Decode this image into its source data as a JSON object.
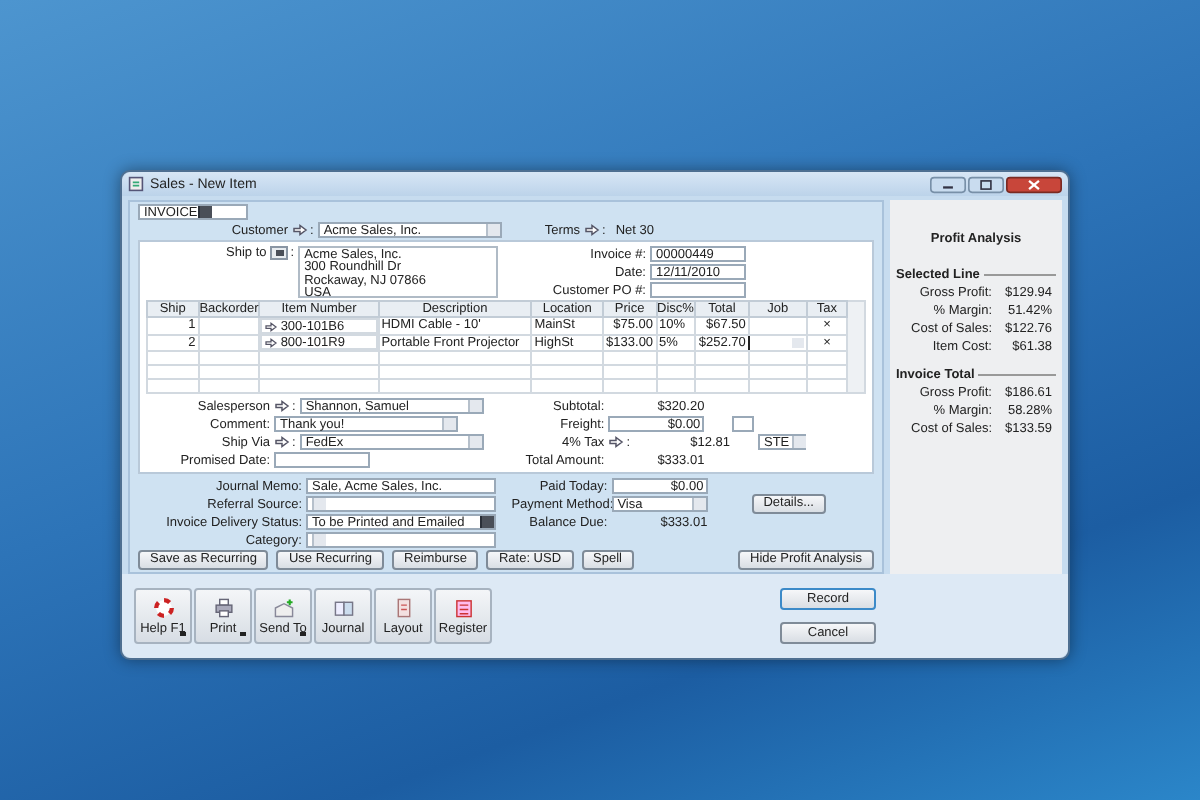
{
  "window": {
    "title": "Sales - New Item"
  },
  "form_type": {
    "value": "INVOICE"
  },
  "customer": {
    "label": "Customer",
    "separator": ":",
    "value": "Acme Sales, Inc."
  },
  "terms": {
    "label": "Terms",
    "separator": ":",
    "value": "Net 30"
  },
  "ship_to": {
    "label": "Ship to",
    "separator": ":",
    "address": [
      "Acme Sales, Inc.",
      "300 Roundhill Dr",
      "Rockaway, NJ 07866",
      "USA"
    ]
  },
  "invoice_fields": [
    {
      "label": "Invoice #:",
      "value": "00000449"
    },
    {
      "label": "Date:",
      "value": "12/11/2010"
    },
    {
      "label": "Customer PO #:"
    }
  ],
  "table": {
    "columns": [
      "Ship",
      "Backorder",
      "Item Number",
      "Description",
      "Location",
      "Price",
      "Disc%",
      "Total",
      "Job",
      "Tax"
    ],
    "rows": [
      {
        "ship": "1",
        "item_number": "300-101B6",
        "description": "HDMI Cable - 10'",
        "location": "MainSt",
        "price": "$75.00",
        "disc": "10%",
        "total": "$67.50",
        "tax": "×",
        "selected": false
      },
      {
        "ship": "2",
        "item_number": "800-101R9",
        "description": "Portable Front Projector",
        "location": "HighSt",
        "price": "$133.00",
        "disc": "5%",
        "total": "$252.70",
        "tax": "×",
        "selected": true
      }
    ]
  },
  "order_fields": [
    {
      "label": "Salesperson",
      "separator": ":",
      "value": "Shannon, Samuel",
      "arrow": true,
      "dropdown": true
    },
    {
      "label": "Comment:",
      "value": "Thank you!",
      "arrow": false,
      "dropdown": true
    },
    {
      "label": "Ship Via",
      "separator": ":",
      "value": "FedEx",
      "arrow": true,
      "dropdown": true
    },
    {
      "label": "Promised Date:",
      "arrow": false,
      "dropdown": false
    }
  ],
  "totals": [
    {
      "label": "Subtotal:",
      "value": "$320.20",
      "kind": "text",
      "arrow": false
    },
    {
      "label": "Freight:",
      "value": "$0.00",
      "kind": "field",
      "arrow": false,
      "checked": false
    },
    {
      "label": "4% Tax",
      "separator": ":",
      "value": "$12.81",
      "kind": "tax",
      "code": "STE",
      "arrow": true
    },
    {
      "label": "Total Amount:",
      "value": "$333.01",
      "kind": "text",
      "arrow": false
    }
  ],
  "memo_fields": [
    {
      "label": "Journal Memo:",
      "value": "Sale, Acme Sales, Inc.",
      "kind": "text"
    },
    {
      "label": "Referral Source:",
      "kind": "combo"
    },
    {
      "label": "Invoice Delivery Status:",
      "value": "To be Printed and Emailed",
      "kind": "select"
    },
    {
      "label": "Category:",
      "kind": "combo"
    }
  ],
  "payment_fields": [
    {
      "label": "Paid Today:",
      "value": "$0.00",
      "kind": "text"
    },
    {
      "label": "Payment Method:",
      "value": "Visa",
      "kind": "combo"
    },
    {
      "label": "Balance Due:",
      "value": "$333.01",
      "kind": "plain"
    }
  ],
  "details_button": "Details...",
  "action_buttons": [
    "Save as Recurring",
    "Use Recurring",
    "Reimburse",
    "Rate: USD",
    "Spell"
  ],
  "hide_profit_button": "Hide Profit Analysis",
  "toolbar": [
    {
      "label": "Help F1",
      "kind": "help",
      "has_menu": true
    },
    {
      "label": "Print",
      "kind": "print",
      "has_menu": true
    },
    {
      "label": "Send To",
      "kind": "send",
      "has_menu": true
    },
    {
      "label": "Journal",
      "kind": "journal",
      "has_menu": false
    },
    {
      "label": "Layout",
      "kind": "layout",
      "has_menu": false
    },
    {
      "label": "Register",
      "kind": "register",
      "has_menu": false
    }
  ],
  "dialog_buttons": [
    "Record",
    "Cancel"
  ],
  "profit_analysis": {
    "title": "Profit Analysis",
    "sections": [
      {
        "title": "Selected Line",
        "rows": [
          {
            "label": "Gross Profit:",
            "value": "$129.94"
          },
          {
            "label": "% Margin:",
            "value": "51.42%"
          },
          {
            "label": "Cost of Sales:",
            "value": "$122.76"
          },
          {
            "label": "Item Cost:",
            "value": "$61.38"
          }
        ]
      },
      {
        "title": "Invoice Total",
        "rows": [
          {
            "label": "Gross Profit:",
            "value": "$186.61"
          },
          {
            "label": "% Margin:",
            "value": "58.28%"
          },
          {
            "label": "Cost of Sales:",
            "value": "$133.59"
          }
        ]
      }
    ]
  }
}
